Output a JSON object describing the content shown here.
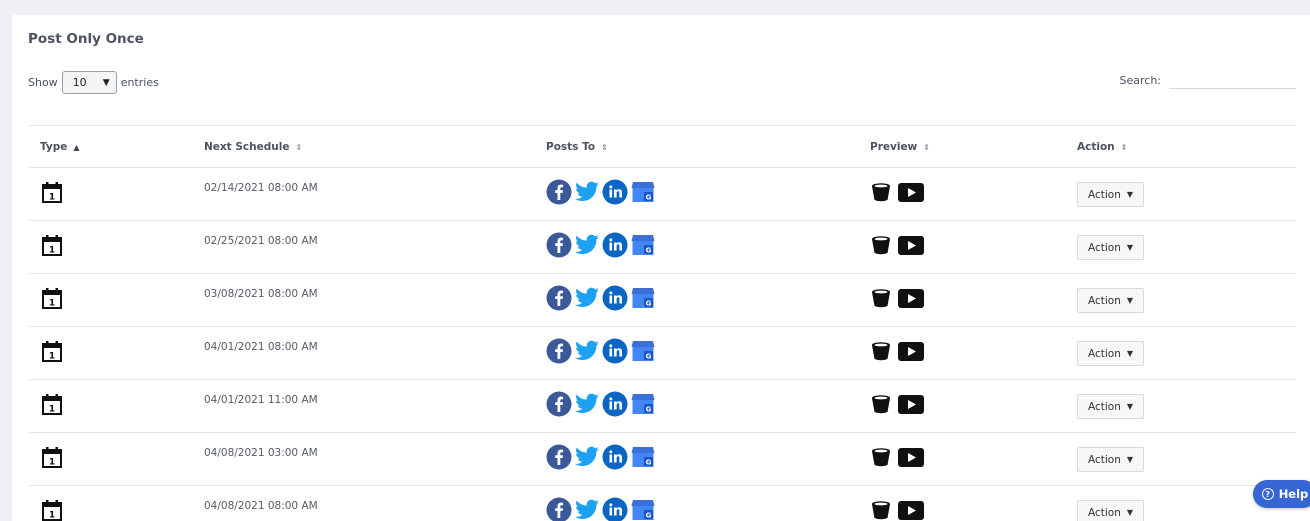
{
  "title": "Post Only Once",
  "length": {
    "show_label": "Show",
    "value": "10",
    "entries_label": "entries"
  },
  "search": {
    "label": "Search:",
    "value": ""
  },
  "columns": [
    "Type",
    "Next Schedule",
    "Posts To",
    "Preview",
    "Action"
  ],
  "sort": {
    "column": "Type",
    "direction": "ascending"
  },
  "rows": [
    {
      "type_icon": "calendar-1-icon",
      "schedule": "02/14/2021 08:00 AM",
      "action": "Action"
    },
    {
      "type_icon": "calendar-1-icon",
      "schedule": "02/25/2021 08:00 AM",
      "action": "Action"
    },
    {
      "type_icon": "calendar-1-icon",
      "schedule": "03/08/2021 08:00 AM",
      "action": "Action"
    },
    {
      "type_icon": "calendar-1-icon",
      "schedule": "04/01/2021 08:00 AM",
      "action": "Action"
    },
    {
      "type_icon": "calendar-1-icon",
      "schedule": "04/01/2021 11:00 AM",
      "action": "Action"
    },
    {
      "type_icon": "calendar-1-icon",
      "schedule": "04/08/2021 03:00 AM",
      "action": "Action"
    },
    {
      "type_icon": "calendar-1-icon",
      "schedule": "04/08/2021 08:00 AM",
      "action": "Action"
    }
  ],
  "posts_to_icons": [
    "facebook-icon",
    "twitter-icon",
    "linkedin-icon",
    "google-my-business-icon"
  ],
  "preview_icons": [
    "bucket-icon",
    "play-icon"
  ],
  "help": {
    "label": "Help"
  },
  "colors": {
    "accent": "#3566d3",
    "facebook": "#3b5998",
    "twitter": "#1da1f2",
    "linkedin": "#0a66c2",
    "gmb": "#4285f4"
  }
}
